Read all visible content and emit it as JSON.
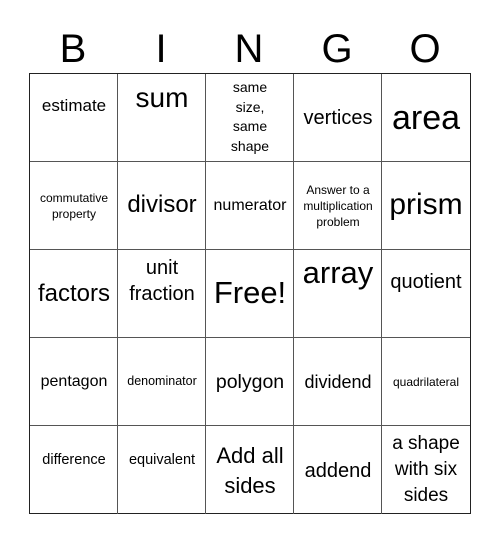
{
  "header": [
    "B",
    "I",
    "N",
    "G",
    "O"
  ],
  "rows": [
    [
      "estimate",
      "sum",
      "same size, same shape",
      "vertices",
      "area"
    ],
    [
      "commutative property",
      "divisor",
      "numerator",
      "Answer to a multiplication problem",
      "prism"
    ],
    [
      "factors",
      "unit fraction",
      "Free!",
      "array",
      "quotient"
    ],
    [
      "pentagon",
      "denominator",
      "polygon",
      "dividend",
      "quadrilateral"
    ],
    [
      "difference",
      "equivalent",
      "Add all sides",
      "addend",
      "a shape with six sides"
    ]
  ]
}
